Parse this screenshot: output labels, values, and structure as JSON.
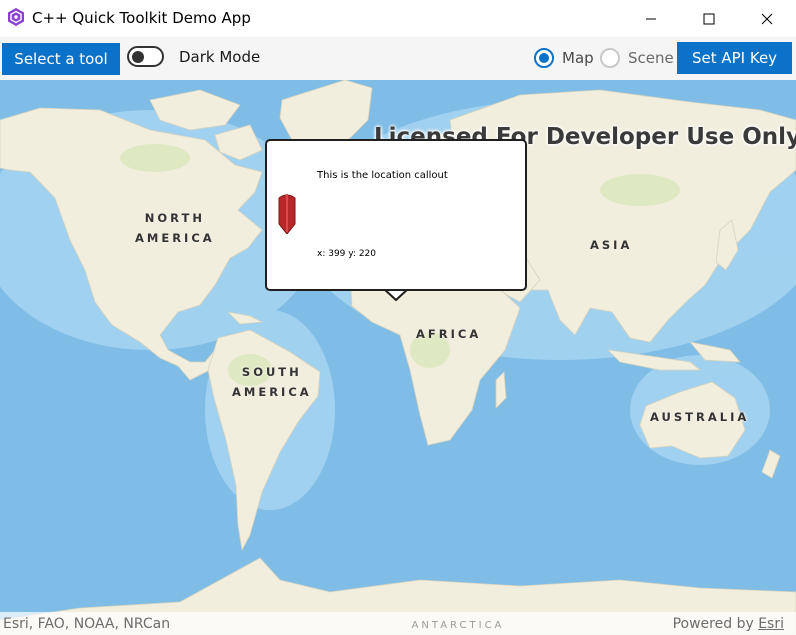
{
  "window": {
    "title": "C++ Quick Toolkit Demo App",
    "icon": "qt-quick-logo-icon",
    "controls": [
      "minimize-icon",
      "maximize-icon",
      "close-icon"
    ]
  },
  "toolbar": {
    "select_tool_label": "Select a tool",
    "dark_mode_label": "Dark Mode",
    "dark_mode_on": false,
    "view_options": [
      {
        "label": "Map",
        "selected": true
      },
      {
        "label": "Scene",
        "selected": false
      }
    ],
    "set_api_key_label": "Set API Key",
    "accent_color": "#0a72c9"
  },
  "map": {
    "watermark": "Licensed For Developer Use Only",
    "region_labels": {
      "north_america": [
        "NORTH",
        "AMERICA"
      ],
      "south_america": [
        "SOUTH",
        "AMERICA"
      ],
      "africa": "AFRICA",
      "asia": "ASIA",
      "australia": "AUSTRALIA",
      "antarctica": "ANTARCTICA"
    },
    "ocean_color": "#85c3ea",
    "land_color": "#f1eedd"
  },
  "callout": {
    "title": "This is the location callout",
    "detail": "x: 399 y: 220",
    "pin_icon": "location-pin-icon",
    "pin_color": "#b8282a"
  },
  "attribution": {
    "sources": "Esri, FAO, NOAA, NRCan",
    "powered_by": "Powered by",
    "powered_by_link": "Esri"
  }
}
